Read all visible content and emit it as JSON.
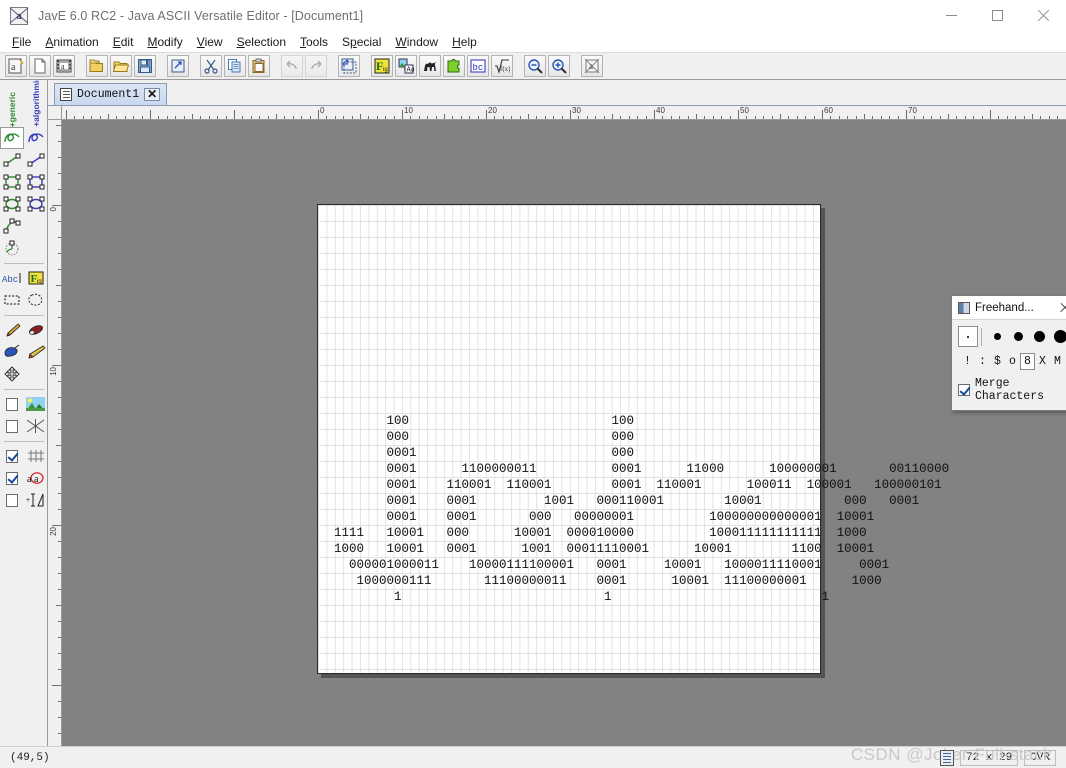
{
  "window": {
    "title": "JavE 6.0 RC2 - Java ASCII Versatile Editor - [Document1]",
    "icon": "jave-app-icon",
    "minimize": "minimize-icon",
    "maximize": "maximize-icon",
    "close": "close-icon"
  },
  "menubar": {
    "items": [
      {
        "label": "File",
        "mnemonic": "F"
      },
      {
        "label": "Animation",
        "mnemonic": "A"
      },
      {
        "label": "Edit",
        "mnemonic": "E"
      },
      {
        "label": "Modify",
        "mnemonic": "M"
      },
      {
        "label": "View",
        "mnemonic": "V"
      },
      {
        "label": "Selection",
        "mnemonic": "S"
      },
      {
        "label": "Tools",
        "mnemonic": "T"
      },
      {
        "label": "Special",
        "mnemonic": "p"
      },
      {
        "label": "Window",
        "mnemonic": "W"
      },
      {
        "label": "Help",
        "mnemonic": "H"
      }
    ]
  },
  "toolbar": {
    "buttons": [
      {
        "name": "new-ascii-art-icon",
        "glyph": "a"
      },
      {
        "name": "new-document-icon",
        "glyph": ""
      },
      {
        "name": "new-animation-icon",
        "glyph": "a"
      },
      {
        "sep": true
      },
      {
        "name": "open-project-icon",
        "glyph": ""
      },
      {
        "name": "open-folder-icon",
        "glyph": ""
      },
      {
        "name": "save-icon",
        "glyph": ""
      },
      {
        "sep": true
      },
      {
        "name": "export-icon",
        "glyph": ""
      },
      {
        "sep": true
      },
      {
        "name": "cut-icon",
        "glyph": ""
      },
      {
        "name": "copy-icon",
        "glyph": ""
      },
      {
        "name": "paste-icon",
        "glyph": ""
      },
      {
        "sep": true
      },
      {
        "name": "undo-icon",
        "glyph": "",
        "disabled": true
      },
      {
        "name": "redo-icon",
        "glyph": "",
        "disabled": true
      },
      {
        "sep": true
      },
      {
        "name": "resize-canvas-icon",
        "glyph": ""
      },
      {
        "sep": true
      },
      {
        "name": "figlet-icon",
        "glyph": "F"
      },
      {
        "name": "image-to-ascii-icon",
        "glyph": ""
      },
      {
        "name": "camel-icon",
        "glyph": ""
      },
      {
        "name": "puzzle-icon",
        "glyph": ""
      },
      {
        "name": "barcode-icon",
        "glyph": "bc"
      },
      {
        "name": "formula-icon",
        "glyph": "f(x)"
      },
      {
        "sep": true
      },
      {
        "name": "zoom-out-icon",
        "glyph": ""
      },
      {
        "name": "zoom-in-icon",
        "glyph": ""
      },
      {
        "sep": true
      },
      {
        "name": "about-icon",
        "glyph": "a"
      }
    ]
  },
  "toolpanel": {
    "column_headers": [
      {
        "label": "+generic",
        "color": "#2f8a2f"
      },
      {
        "label": "+algorithmic",
        "color": "#3a3ac0"
      }
    ],
    "tools": [
      {
        "generic": "freehand-generic-tool",
        "algorithmic": "freehand-algorithmic-tool",
        "selected": "generic"
      },
      {
        "generic": "line-generic-tool",
        "algorithmic": "line-algorithmic-tool"
      },
      {
        "generic": "rectangle-generic-tool",
        "algorithmic": "rectangle-algorithmic-tool"
      },
      {
        "generic": "ellipse-generic-tool",
        "algorithmic": "ellipse-algorithmic-tool"
      },
      {
        "generic": "curve-generic-tool",
        "algorithmic": null
      },
      {
        "generic": "arc-generic-tool",
        "algorithmic": null
      }
    ],
    "tools2": [
      {
        "generic": "text-tool",
        "algorithmic": "figlet-text-tool"
      },
      {
        "generic": "rect-select-tool",
        "algorithmic": "lasso-select-tool"
      }
    ],
    "tools3": [
      {
        "generic": "paintbrush-tool",
        "algorithmic": "eraser-tool"
      },
      {
        "generic": "fill-tool",
        "algorithmic": "airbrush-tool"
      },
      {
        "generic": "move-tool",
        "algorithmic": null
      }
    ],
    "options": [
      {
        "name": "background-image-option",
        "checked": false,
        "icon": "landscape-icon"
      },
      {
        "name": "shadow-option",
        "checked": false,
        "icon": "crosshatch-icon"
      }
    ],
    "options2": [
      {
        "name": "show-grid-option",
        "checked": true,
        "icon": "grid-icon"
      },
      {
        "name": "highlight-chars-option",
        "checked": true,
        "icon": "red-a-icon"
      },
      {
        "name": "show-ruler-option",
        "checked": false,
        "icon": "measure-icon"
      }
    ]
  },
  "tabs": [
    {
      "label": "Document1",
      "icon": "document-icon",
      "close": "✕",
      "active": true
    }
  ],
  "rulers": {
    "horizontal": {
      "labels": [
        "0",
        "10",
        "20",
        "30",
        "40",
        "50",
        "60",
        "70"
      ],
      "step": 10
    },
    "vertical": {
      "labels": [
        "0",
        "10",
        "20"
      ],
      "step": 10
    }
  },
  "canvas": {
    "cols": 72,
    "rows": 29,
    "art_lines": [
      "         100                           100",
      "         000                           000",
      "         0001                          000",
      "         0001      1100000011          0001      11000      100000001       00110000",
      "         0001    110001  110001        0001  110001      100011  100001   100000101",
      "         0001    0001         1001   000110001        10001           000   0001",
      "         0001    0001       000   00000001          100000000000001  10001",
      "  1111   10001   000      10001  000010000          100011111111111  1000",
      "  1000   10001   0001      1001  00011110001      10001        1100  10001",
      "    000001000011    10000111100001   0001     10001   1000011110001     0001",
      "     1000000111       11100000011    0001      10001  11100000001      1000",
      "          1                           1                            1"
    ]
  },
  "dialog": {
    "title": "Freehand...",
    "icon": "freehand-dialog-icon",
    "close": "close-icon",
    "brush_selected_size": 1,
    "brush_sizes": [
      7,
      9,
      11,
      13
    ],
    "characters": [
      "!",
      ":",
      "$",
      "o",
      "8",
      "X",
      "M"
    ],
    "character_selected": "8",
    "merge_characters": {
      "label": "Merge Characters",
      "checked": true
    }
  },
  "statusbar": {
    "cursor": "(49,5)",
    "doc_size": "72 x 29",
    "insert_mode": "OVR",
    "icon": "doc-info-icon"
  },
  "watermark": "CSDN @Joker-Full-stack",
  "colors": {
    "canvas_bg": "#828282",
    "sheet_bg": "#ffffff",
    "grid_line": "#e2e2e2",
    "chrome": "#f0f0f0",
    "generic_green": "#2f8a2f",
    "algorithmic_blue": "#3a3ac0",
    "tab_blue": "#c7d8ef"
  }
}
